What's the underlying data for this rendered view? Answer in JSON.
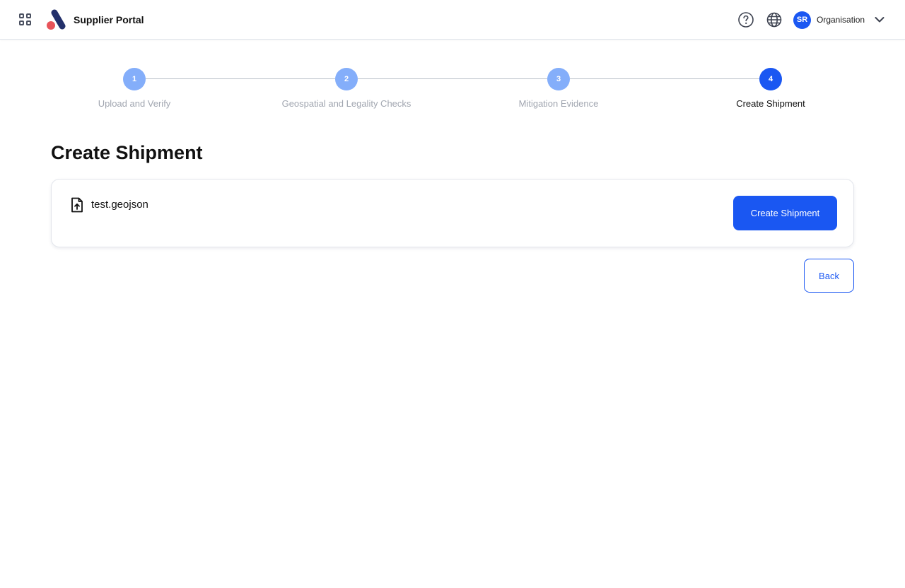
{
  "header": {
    "title": "Supplier Portal",
    "user_initials": "SR",
    "organisation": "Organisation"
  },
  "stepper": {
    "current_step": 4,
    "steps": [
      {
        "number": "1",
        "label": "Upload and Verify"
      },
      {
        "number": "2",
        "label": "Geospatial and Legality Checks"
      },
      {
        "number": "3",
        "label": "Mitigation Evidence"
      },
      {
        "number": "4",
        "label": "Create Shipment"
      }
    ]
  },
  "main": {
    "title": "Create Shipment",
    "file": {
      "name": "test.geojson",
      "icon": "file-upload-icon"
    },
    "create_button_label": "Create Shipment",
    "back_button_label": "Back"
  },
  "colors": {
    "primary": "#1a57f2",
    "step_done": "#84aefa",
    "muted_text": "#a1a6b0",
    "logo_navy": "#23306b",
    "logo_red": "#e8545a"
  }
}
